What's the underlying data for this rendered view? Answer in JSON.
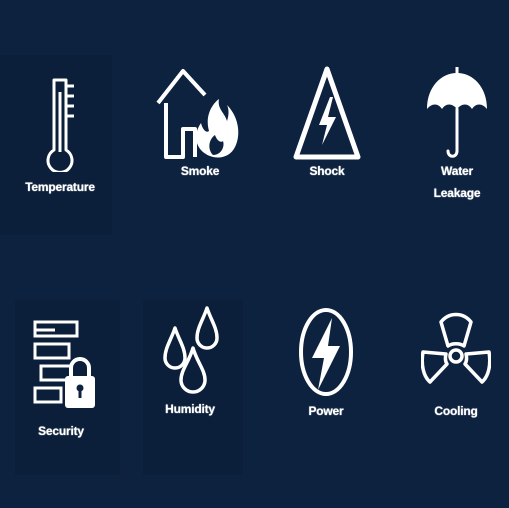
{
  "tiles": [
    {
      "id": "temperature",
      "label": "Temperature",
      "icon": "thermometer-icon"
    },
    {
      "id": "smoke",
      "label": "Smoke",
      "icon": "house-fire-icon"
    },
    {
      "id": "shock",
      "label": "Shock",
      "icon": "high-voltage-warning-icon"
    },
    {
      "id": "water-leakage",
      "label_line1": "Water",
      "label_line2": "Leakage",
      "icon": "umbrella-icon"
    },
    {
      "id": "security",
      "label": "Security",
      "icon": "server-lock-icon"
    },
    {
      "id": "humidity",
      "label": "Humidity",
      "icon": "water-drops-icon"
    },
    {
      "id": "power",
      "label": "Power",
      "icon": "lightning-bolt-icon"
    },
    {
      "id": "cooling",
      "label": "Cooling",
      "icon": "fan-icon"
    }
  ],
  "colors": {
    "background": "#0d223f",
    "icon": "#ffffff"
  }
}
